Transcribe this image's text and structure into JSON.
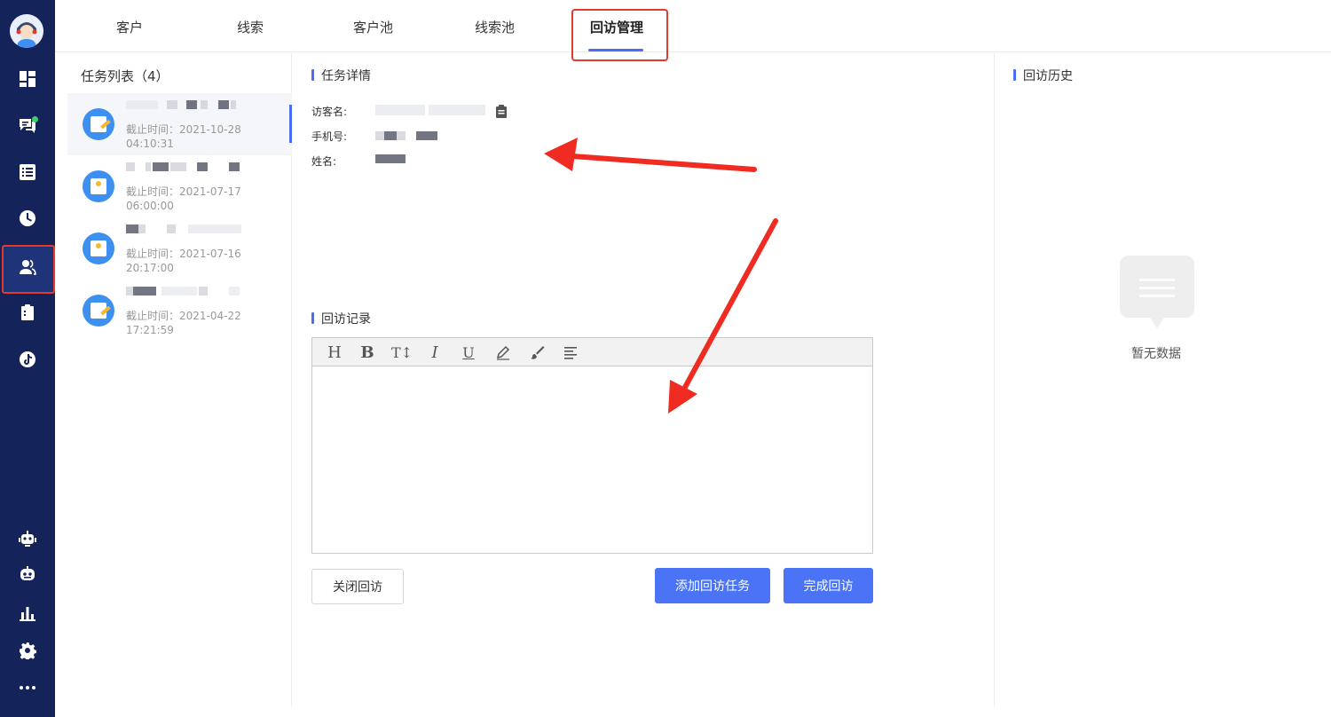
{
  "sidebar": {
    "items": [
      {
        "icon": "dashboard-icon"
      },
      {
        "icon": "chat-icon",
        "badge": "online-dot"
      },
      {
        "icon": "list-icon"
      },
      {
        "icon": "clock-icon"
      },
      {
        "icon": "users-icon",
        "active": true
      },
      {
        "icon": "clipboard-icon"
      },
      {
        "icon": "tiktok-icon"
      },
      {
        "icon": "robot-icon"
      },
      {
        "icon": "robot-alt-icon"
      },
      {
        "icon": "bar-chart-icon"
      },
      {
        "icon": "gear-icon"
      },
      {
        "icon": "more-icon"
      }
    ]
  },
  "tabs": [
    {
      "label": "客户"
    },
    {
      "label": "线索"
    },
    {
      "label": "客户池"
    },
    {
      "label": "线索池"
    },
    {
      "label": "回访管理",
      "active": true
    }
  ],
  "task_list": {
    "title": "任务列表（4）",
    "tasks": [
      {
        "deadline_label": "截止时间：2021-10-28",
        "deadline_time": "04:10:31",
        "active": true
      },
      {
        "deadline_label": "截止时间：2021-07-17",
        "deadline_time": "06:00:00"
      },
      {
        "deadline_label": "截止时间：2021-07-16",
        "deadline_time": "20:17:00"
      },
      {
        "deadline_label": "截止时间：2021-04-22",
        "deadline_time": "17:21:59"
      }
    ]
  },
  "detail": {
    "title": "任务详情",
    "fields": {
      "visitor_name_label": "访客名:",
      "phone_label": "手机号:",
      "name_label": "姓名:"
    }
  },
  "record": {
    "title": "回访记录",
    "toolbar": [
      "H",
      "B",
      "T↕",
      "I",
      "U",
      "pen-icon",
      "brush-icon",
      "align-icon"
    ]
  },
  "buttons": {
    "close": "关闭回访",
    "add_task": "添加回访任务",
    "complete": "完成回访"
  },
  "history": {
    "title": "回访历史",
    "empty_text": "暂无数据"
  },
  "colors": {
    "sidebar_bg": "#14235a",
    "accent": "#4a6cf7",
    "primary_button": "#4a74f5",
    "annotation_red": "#e23a2f"
  }
}
